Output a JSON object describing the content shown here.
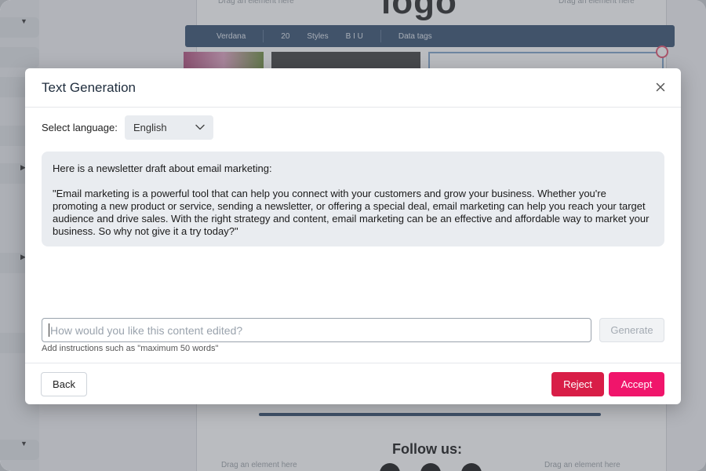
{
  "background": {
    "logo_text": "logo",
    "drop_placeholder": "Drag an element here",
    "toolbar": {
      "font": "Verdana",
      "size": "20",
      "styles": "Styles",
      "data_tags": "Data tags"
    },
    "follow_text": "Follow us:"
  },
  "modal": {
    "title": "Text Generation",
    "close_icon": "close-icon",
    "language": {
      "label": "Select language:",
      "selected": "English",
      "icon": "chevron-down-icon"
    },
    "generated": {
      "intro": "Here is a newsletter draft about email marketing:",
      "body": "\"Email marketing is a powerful tool that can help you connect with your customers and grow your business. Whether you're promoting a new product or service, sending a newsletter, or offering a special deal, email marketing can help you reach your target audience and drive sales. With the right strategy and content, email marketing can be an effective and affordable way to market your business. So why not give it a try today?\""
    },
    "edit": {
      "placeholder": "How would you like this content edited?",
      "value": "",
      "hint": "Add instructions such as \"maximum 50 words\"",
      "generate_label": "Generate"
    },
    "footer": {
      "back_label": "Back",
      "reject_label": "Reject",
      "accept_label": "Accept"
    }
  },
  "colors": {
    "reject": "#d81e47",
    "accept": "#f0156b",
    "toolbar": "#2f4a6b",
    "content_bg": "#e9ecf0"
  }
}
